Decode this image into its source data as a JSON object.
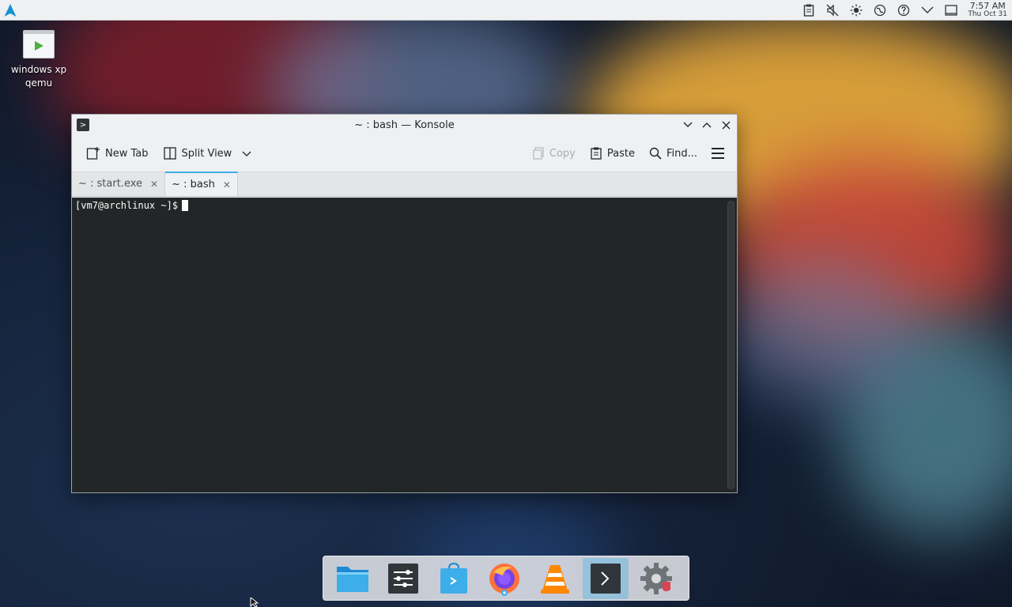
{
  "top_panel": {
    "launcher_icon": "arch-logo-icon",
    "tray_icons": [
      "clipboard-icon",
      "volume-muted-icon",
      "brightness-icon",
      "network-icon",
      "help-icon",
      "chevron-down-icon",
      "desktop-icon"
    ],
    "clock": {
      "time": "7:57 AM",
      "date": "Thu Oct 31"
    }
  },
  "desktop": {
    "icons": [
      {
        "label": "windows xp qemu",
        "icon": "play-icon"
      }
    ]
  },
  "window": {
    "title": "~ : bash — Konsole",
    "toolbar": {
      "new_tab": "New Tab",
      "split_view": "Split View",
      "copy": "Copy",
      "paste": "Paste",
      "find": "Find..."
    },
    "tabs": [
      {
        "label": "~ : start.exe",
        "active": false
      },
      {
        "label": "~ : bash",
        "active": true
      }
    ],
    "terminal": {
      "prompt": "[vm7@archlinux ~]$"
    }
  },
  "dock": {
    "items": [
      "file-manager-icon",
      "system-settings-sliders-icon",
      "discover-store-icon",
      "firefox-icon",
      "vlc-icon",
      "konsole-icon",
      "settings-gear-icon"
    ],
    "active_item": "konsole-icon"
  },
  "colors": {
    "accent": "#3daee9",
    "terminal_bg": "#232627",
    "panel_bg": "#eef0f2"
  }
}
